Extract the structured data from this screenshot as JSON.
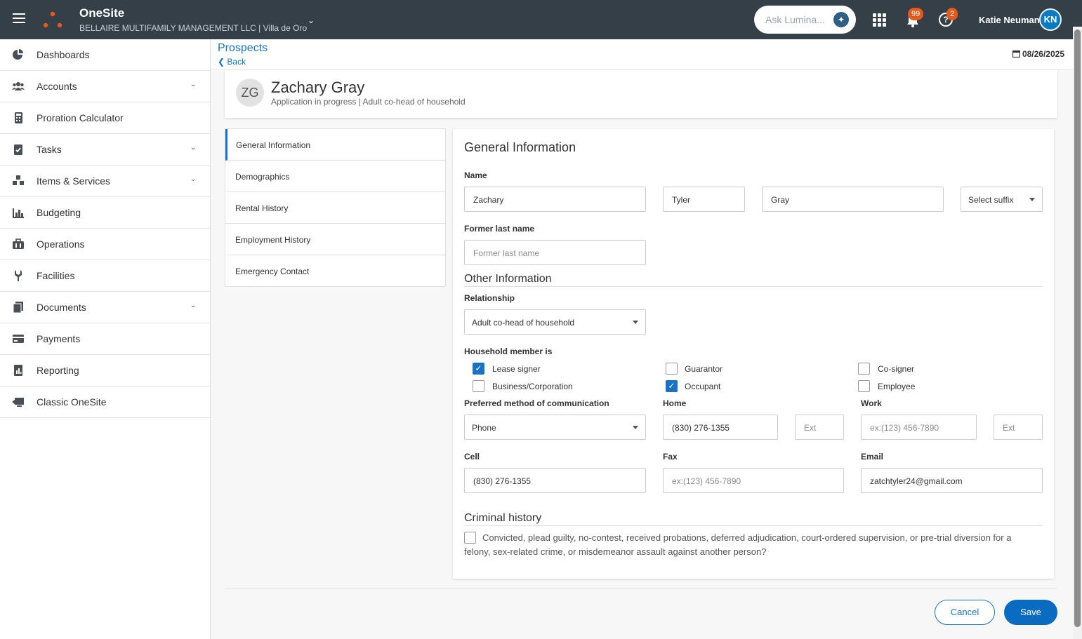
{
  "topbar": {
    "app_title": "OneSite",
    "company": "BELLAIRE MULTIFAMILY MANAGEMENT LLC | Villa de Oro",
    "ask_placeholder": "Ask Lumina...",
    "notifications_count": "99",
    "help_count": "2",
    "user_name": "Katie Neuman",
    "user_initials": "KN",
    "brand_color": "#343f48",
    "accent_color": "#e55a1c"
  },
  "sidebar": {
    "items": [
      {
        "label": "Dashboards",
        "icon": "pie-chart-icon",
        "expandable": false
      },
      {
        "label": "Accounts",
        "icon": "users-icon",
        "expandable": true
      },
      {
        "label": "Proration Calculator",
        "icon": "calculator-icon",
        "expandable": false
      },
      {
        "label": "Tasks",
        "icon": "clipboard-check-icon",
        "expandable": true
      },
      {
        "label": "Items & Services",
        "icon": "boxes-icon",
        "expandable": true
      },
      {
        "label": "Budgeting",
        "icon": "bar-chart-icon",
        "expandable": false
      },
      {
        "label": "Operations",
        "icon": "briefcase-icon",
        "expandable": false
      },
      {
        "label": "Facilities",
        "icon": "wrench-icon",
        "expandable": false
      },
      {
        "label": "Documents",
        "icon": "documents-icon",
        "expandable": true
      },
      {
        "label": "Payments",
        "icon": "credit-card-icon",
        "expandable": false
      },
      {
        "label": "Reporting",
        "icon": "report-icon",
        "expandable": false
      },
      {
        "label": "Classic OneSite",
        "icon": "classic-icon",
        "expandable": false
      }
    ]
  },
  "header": {
    "breadcrumb": "Prospects",
    "back": "Back",
    "date": "08/26/2025"
  },
  "person": {
    "initials": "ZG",
    "name": "Zachary Gray",
    "subtitle": "Application in progress  |  Adult co-head of household"
  },
  "section_nav": {
    "items": [
      "General Information",
      "Demographics",
      "Rental History",
      "Employment History",
      "Emergency Contact"
    ],
    "active": "General Information"
  },
  "form": {
    "title": "General Information",
    "name_label": "Name",
    "first_name": "Zachary",
    "middle_name": "Tyler",
    "last_name": "Gray",
    "suffix_placeholder": "Select suffix",
    "former_last_label": "Former last name",
    "former_last_placeholder": "Former last name",
    "other_info_heading": "Other Information",
    "relationship_label": "Relationship",
    "relationship_value": "Adult co-head of household",
    "member_label": "Household member is",
    "member_options": [
      {
        "label": "Lease signer",
        "checked": true
      },
      {
        "label": "Guarantor",
        "checked": false
      },
      {
        "label": "Co-signer",
        "checked": false
      },
      {
        "label": "Business/Corporation",
        "checked": false
      },
      {
        "label": "Occupant",
        "checked": true
      },
      {
        "label": "Employee",
        "checked": false
      }
    ],
    "pref_comm_label": "Preferred method of communication",
    "pref_comm_value": "Phone",
    "home_label": "Home",
    "home_value": "(830) 276-1355",
    "ext_placeholder": "Ext",
    "work_label": "Work",
    "phone_placeholder": "ex:(123) 456-7890",
    "cell_label": "Cell",
    "cell_value": "(830) 276-1355",
    "fax_label": "Fax",
    "email_label": "Email",
    "email_value": "zatchtyler24@gmail.com",
    "criminal_heading": "Criminal history",
    "criminal_question": "Convicted, plead guilty, no-contest, received probations, deferred adjudication, court-ordered supervision, or pre-trial diversion for a felony, sex-related crime, or misdemeanor assault against another person?",
    "criminal_checked": false
  },
  "actions": {
    "cancel": "Cancel",
    "save": "Save"
  }
}
